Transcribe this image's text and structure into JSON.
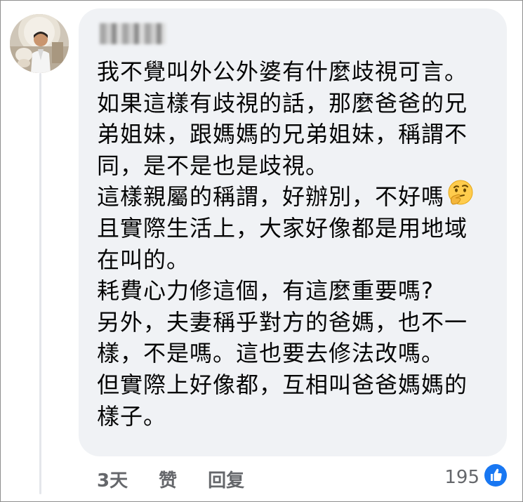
{
  "comment": {
    "author_name": "████",
    "lines": [
      "我不覺叫外公外婆有什麼歧視可言。",
      "如果這樣有歧視的話，那麼爸爸的兄",
      "弟姐妹，跟媽媽的兄弟姐妹，稱謂不",
      "同，是不是也是歧視。",
      "這樣親屬的稱謂，好辦別，不好嗎",
      "且實際生活上，大家好像都是用地域",
      "在叫的。",
      "耗費心力修這個，有這麼重要嗎?",
      "另外，夫妻稱乎對方的爸媽，也不一",
      "樣，不是嗎。這也要去修法改嗎。",
      "但實際上好像都，互相叫爸爸媽媽的",
      "樣子。"
    ],
    "inline_emoji": "thinking-face-icon"
  },
  "actions": {
    "time": "3天",
    "like_label": "赞",
    "reply_label": "回复"
  },
  "reactions": {
    "count": "195",
    "icon": "like-reaction-icon",
    "icon_color": "#1877f2"
  },
  "colors": {
    "bubble_bg": "#f0f2f5",
    "text": "#050505",
    "secondary_text": "#65676b",
    "accent": "#1877f2"
  }
}
